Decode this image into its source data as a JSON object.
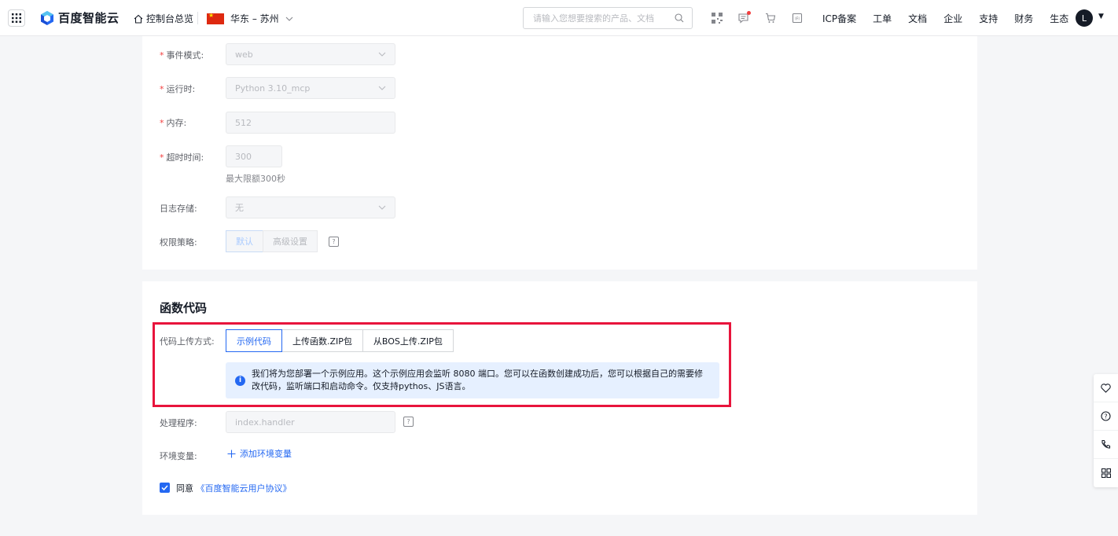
{
  "nav": {
    "logo_text": "百度智能云",
    "console_label": "控制台总览",
    "region_label": "华东 – 苏州",
    "search_placeholder": "请输入您想要搜索的产品、文档",
    "links": [
      "ICP备案",
      "工单",
      "文档",
      "企业",
      "支持",
      "财务",
      "生态"
    ],
    "avatar_letter": "L"
  },
  "form": {
    "event_mode": {
      "label": "事件模式:",
      "value": "web"
    },
    "runtime": {
      "label": "运行时:",
      "value": "Python 3.10_mcp"
    },
    "memory": {
      "label": "内存:",
      "value": "512"
    },
    "timeout": {
      "label": "超时时间:",
      "value": "300",
      "hint": "最大限额300秒"
    },
    "log_storage": {
      "label": "日志存储:",
      "value": "无"
    },
    "permission": {
      "label": "权限策略:",
      "options": [
        "默认",
        "高级设置"
      ]
    }
  },
  "code_section": {
    "title": "函数代码",
    "upload_label": "代码上传方式:",
    "tabs": [
      "示例代码",
      "上传函数.ZIP包",
      "从BOS上传.ZIP包"
    ],
    "info_text": "我们将为您部署一个示例应用。这个示例应用会监听 8080 端口。您可以在函数创建成功后，您可以根据自己的需要修改代码，监听端口和启动命令。仅支持pythos、JS语言。",
    "handler": {
      "label": "处理程序:",
      "placeholder": "index.handler"
    },
    "env": {
      "label": "环境变量:",
      "add_label": "添加环境变量"
    },
    "agree_prefix": "同意",
    "agree_link": "《百度智能云用户协议》"
  },
  "colors": {
    "primary": "#2468f2",
    "highlight": "#e8143c",
    "required": "#f33e3e"
  }
}
